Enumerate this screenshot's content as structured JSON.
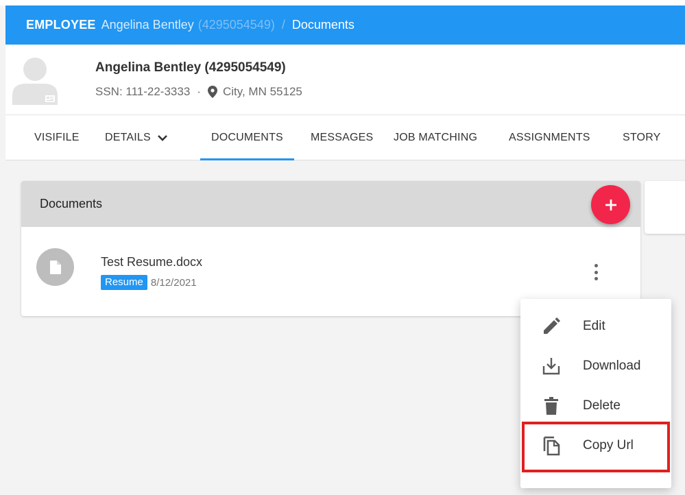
{
  "breadcrumb": {
    "module": "EMPLOYEE",
    "employee_name": "Angelina Bentley",
    "employee_id": "(4295054549)",
    "separator": "/",
    "page": "Documents"
  },
  "employee": {
    "full_name": "Angelina Bentley (4295054549)",
    "ssn": "SSN: 111-22-3333",
    "dot": "·",
    "location": "City, MN 55125"
  },
  "tabs": [
    {
      "label": "VISIFILE"
    },
    {
      "label": "DETAILS"
    },
    {
      "label": "DOCUMENTS",
      "active": true
    },
    {
      "label": "MESSAGES"
    },
    {
      "label": "JOB MATCHING"
    },
    {
      "label": "ASSIGNMENTS"
    },
    {
      "label": "STORY"
    }
  ],
  "documents_panel": {
    "title": "Documents",
    "items": [
      {
        "name": "Test Resume.docx",
        "type": "Resume",
        "date": "8/12/2021"
      }
    ]
  },
  "context_menu": {
    "items": [
      {
        "label": "Edit",
        "icon": "pencil-icon"
      },
      {
        "label": "Download",
        "icon": "download-icon"
      },
      {
        "label": "Delete",
        "icon": "trash-icon"
      },
      {
        "label": "Copy Url",
        "icon": "copy-icon"
      }
    ]
  },
  "colors": {
    "primary": "#2196f3",
    "fab": "#f2264a",
    "highlight": "#e0201f"
  }
}
